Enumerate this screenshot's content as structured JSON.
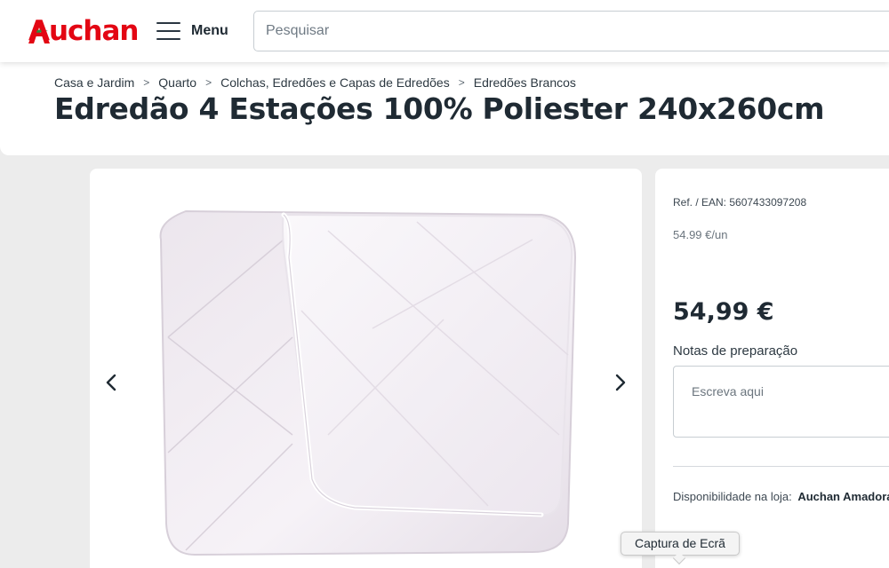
{
  "header": {
    "logo_text": "Auchan",
    "menu_label": "Menu",
    "search_placeholder": "Pesquisar",
    "brand_color": "#e30613"
  },
  "breadcrumb": [
    "Casa e Jardim",
    "Quarto",
    "Colchas, Edredões e Capas de Edredões",
    "Edredões Brancos"
  ],
  "product": {
    "title": "Edredão 4 Estações 100% Poliester 240x260cm",
    "ref_ean": "Ref. / EAN: 5607433097208",
    "unit_price": "54.99 €/un",
    "price": "54,99 €",
    "notes_label": "Notas de preparação",
    "notes_placeholder": "Escreva aqui",
    "availability_label": "Disponibilidade na loja:",
    "availability_store": "Auchan Amadora"
  },
  "gallery": {
    "prev_icon": "chevron-left-icon",
    "next_icon": "chevron-right-icon",
    "image_subject": "folded white duvet"
  },
  "tooltip": {
    "text": "Captura de Ecrã"
  }
}
